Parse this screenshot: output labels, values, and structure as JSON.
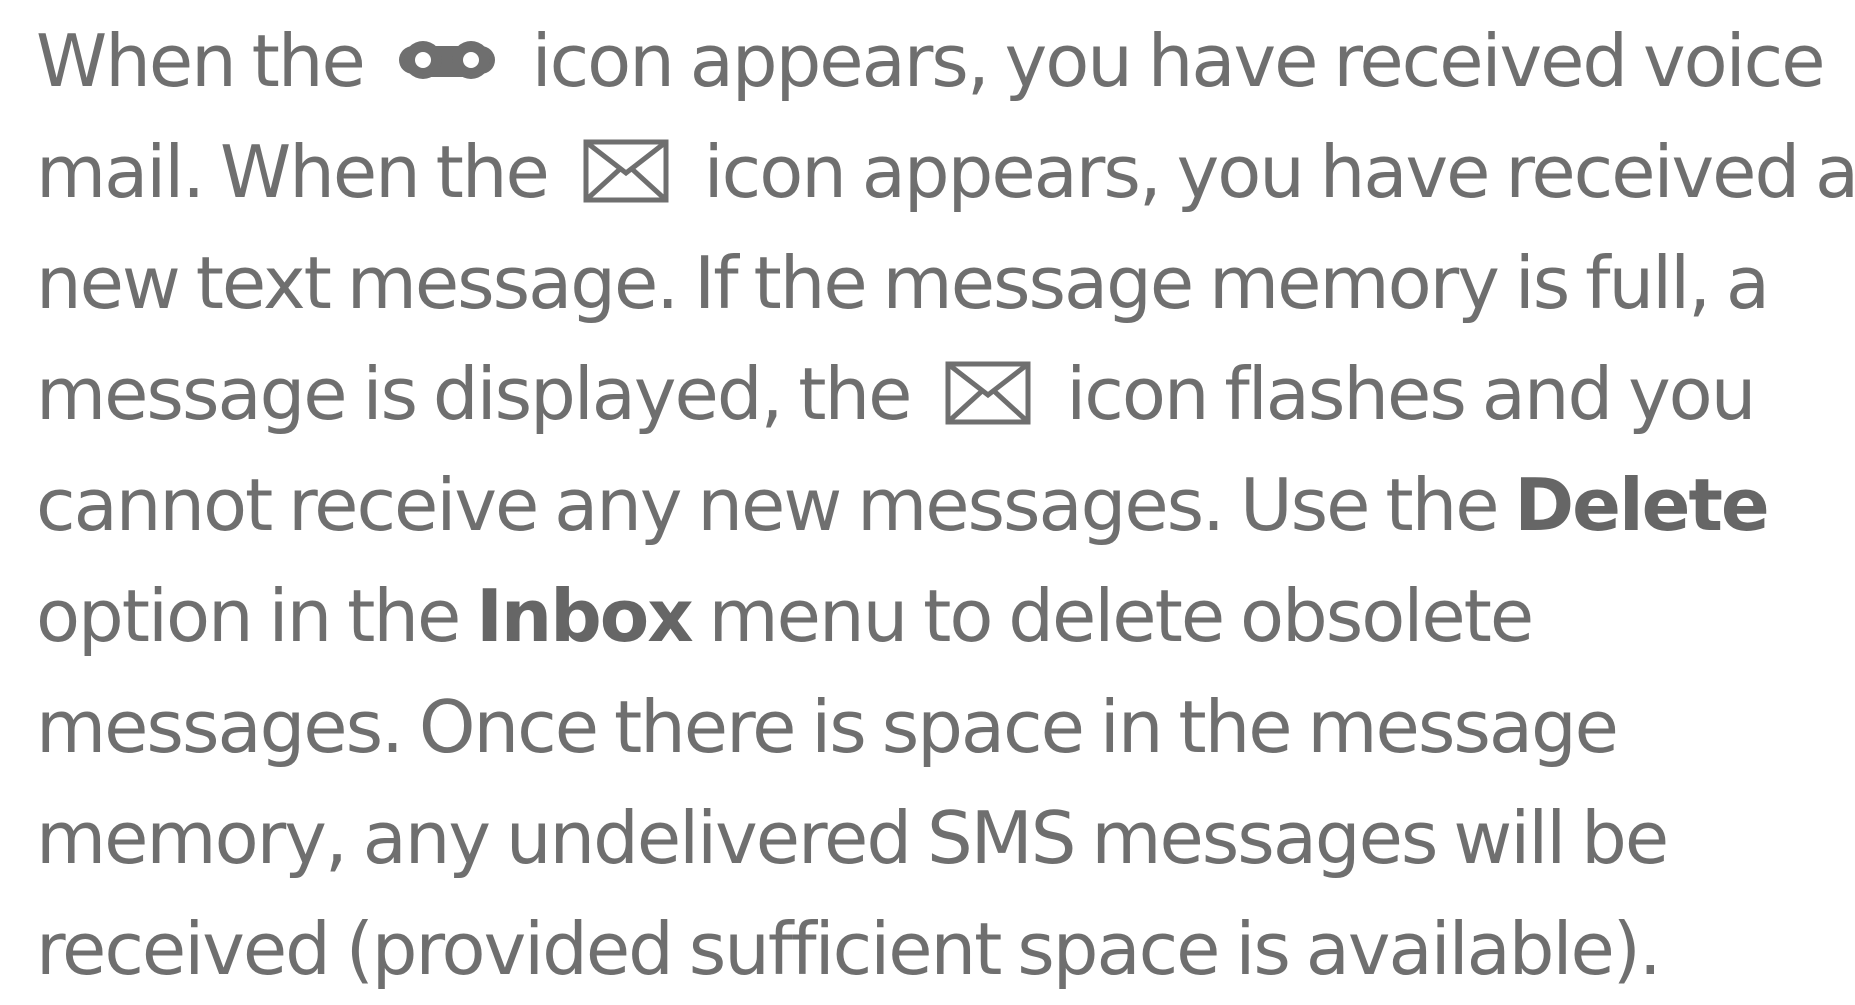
{
  "document": {
    "lines": [
      {
        "parts": [
          "When the",
          "icon appears, you have received voice"
        ]
      },
      {
        "parts": [
          "mail. When the",
          "icon appears, you have received a"
        ]
      },
      {
        "text": "new text message. If the message memory is full, a"
      },
      {
        "parts": [
          "message is displayed, the",
          "icon flashes and you"
        ]
      },
      {
        "parts": [
          "cannot receive any new messages. Use the",
          "Delete"
        ]
      },
      {
        "parts": [
          "option in the",
          "Inbox",
          "menu to delete obsolete"
        ]
      },
      {
        "text": "messages. Once there is space in the message"
      },
      {
        "text": "memory, any undelivered SMS messages will be"
      },
      {
        "text": "received (provided sufficient space is available)."
      }
    ],
    "icons": {
      "voicemail": "voicemail-icon",
      "message": "envelope-icon"
    }
  }
}
